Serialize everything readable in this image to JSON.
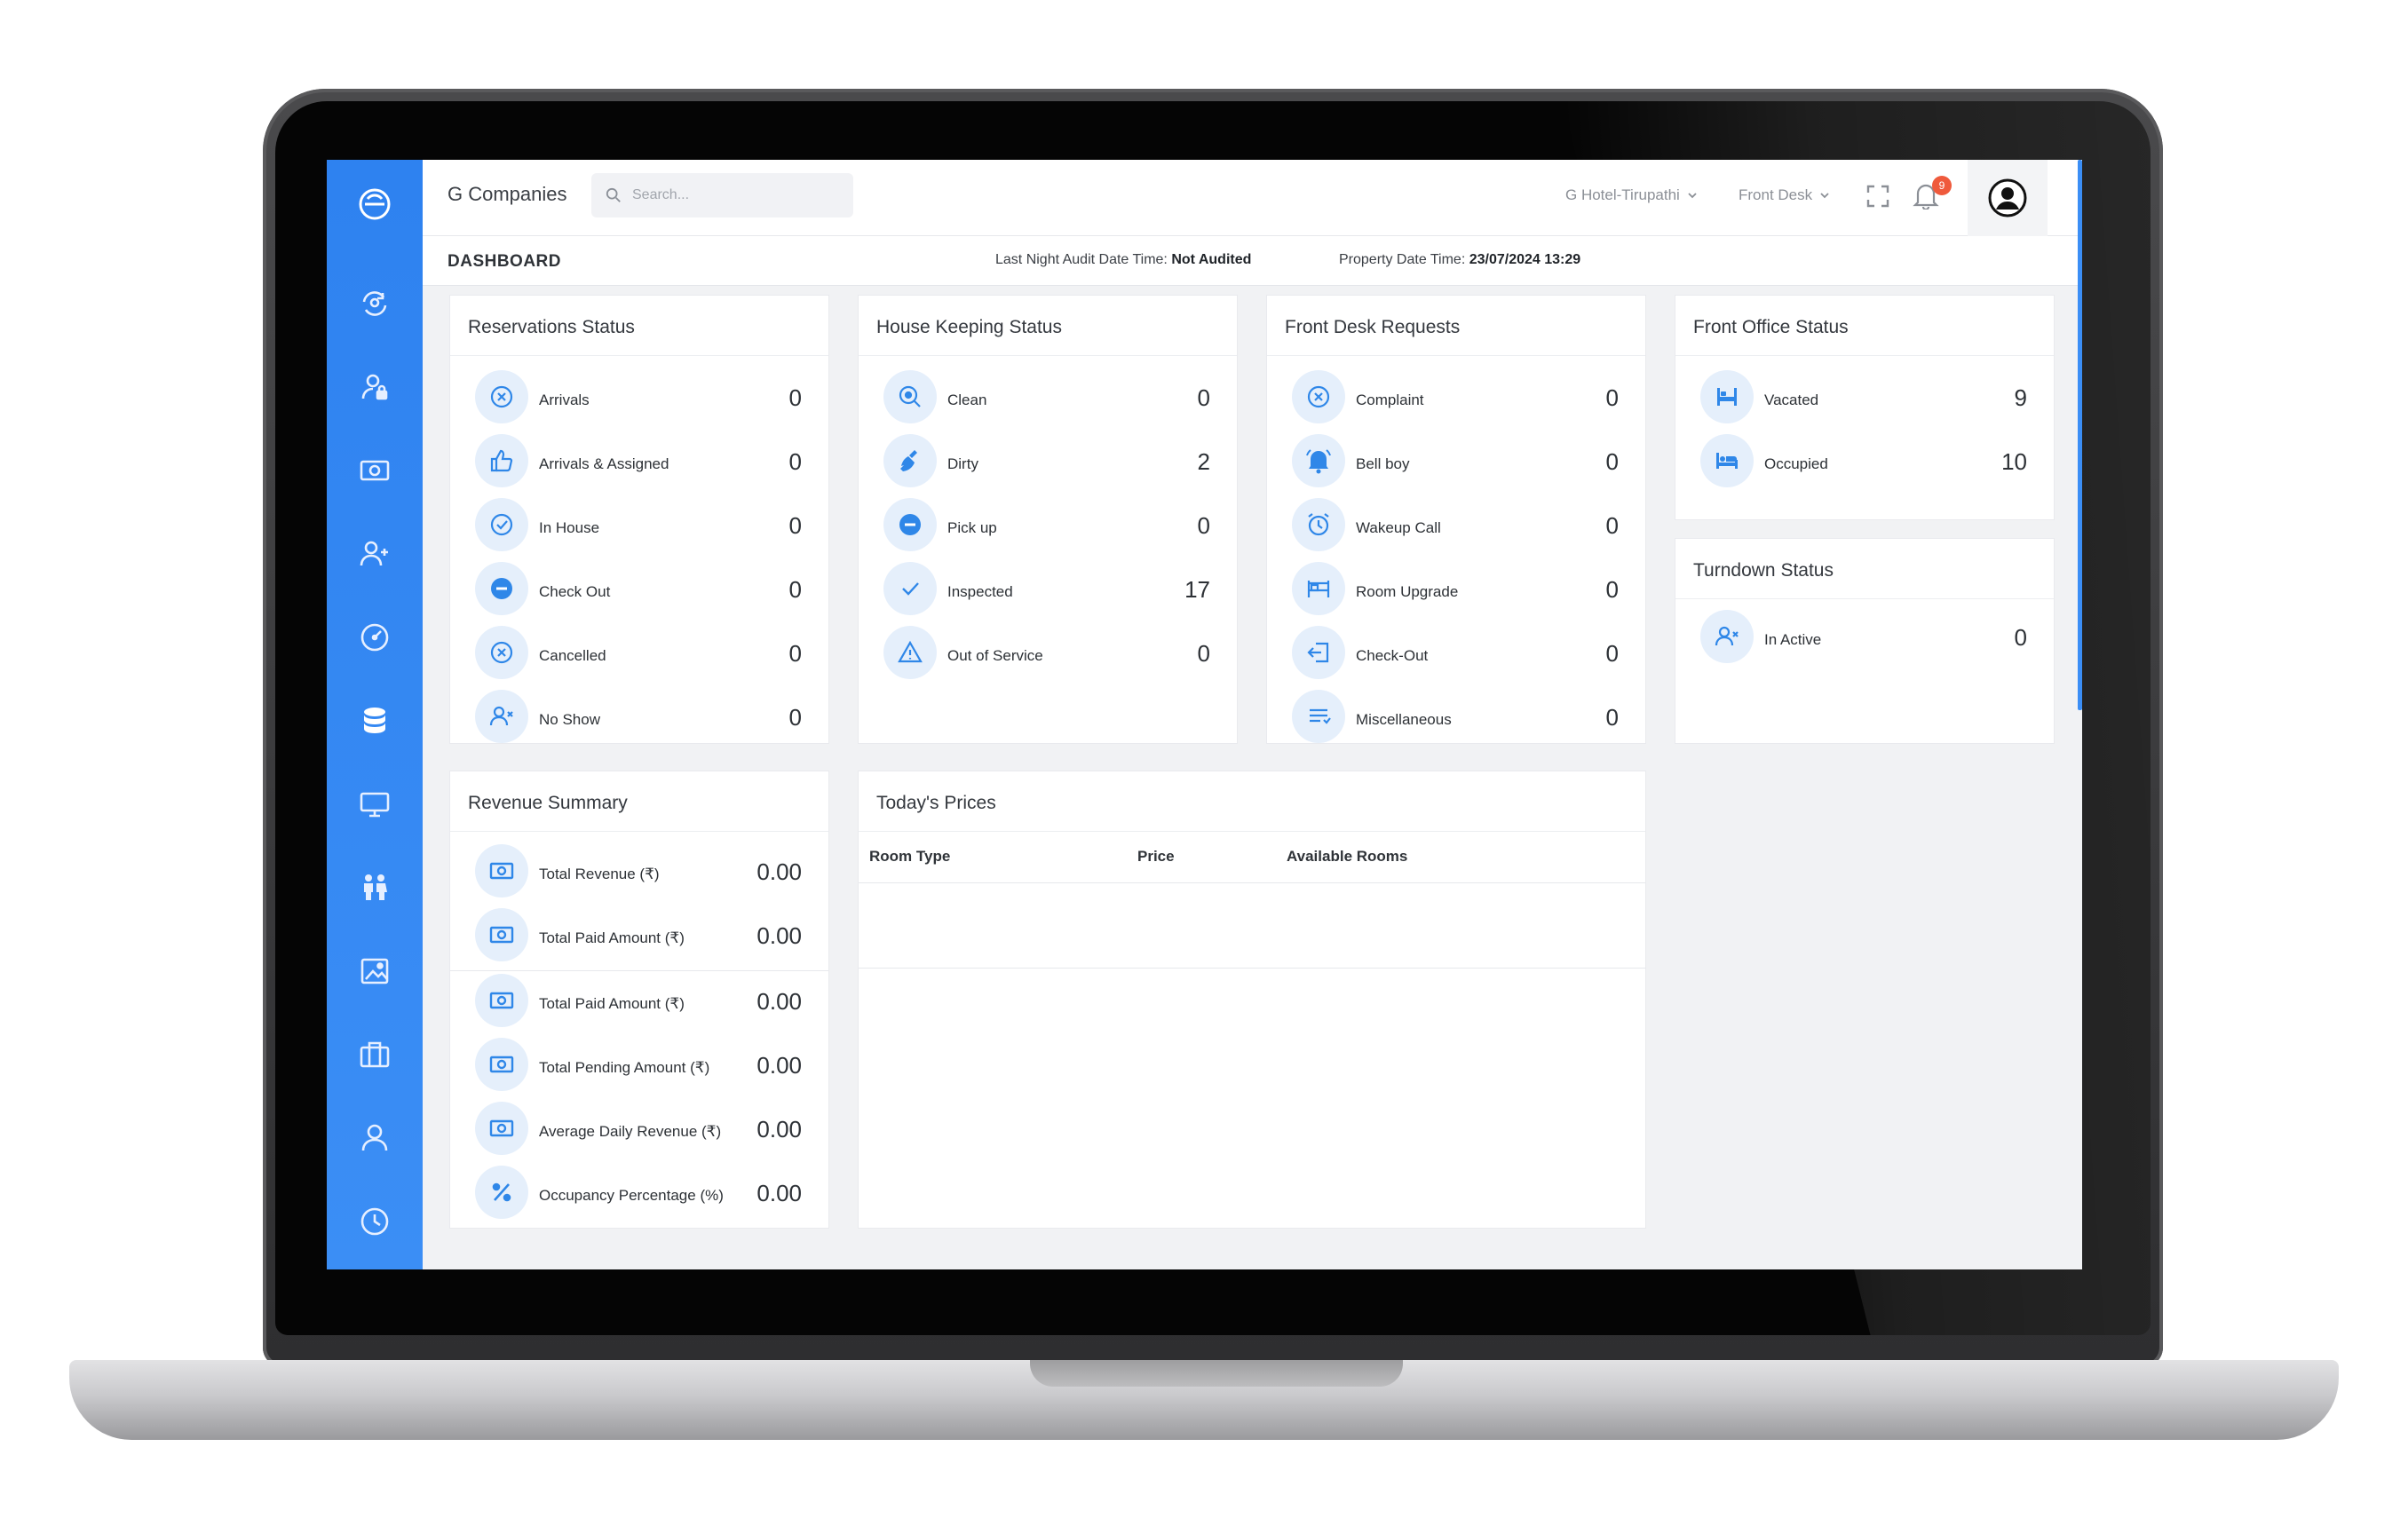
{
  "header": {
    "company": "G Companies",
    "search_placeholder": "Search...",
    "hotel_selector": "G Hotel-Tirupathi",
    "module_selector": "Front Desk",
    "notification_count": "9"
  },
  "subheader": {
    "title": "DASHBOARD",
    "audit_label": "Last Night Audit Date Time:",
    "audit_value": "Not Audited",
    "property_label": "Property Date Time:",
    "property_value": "23/07/2024 13:29"
  },
  "sidebar": {
    "icons": [
      "logo-icon",
      "refresh-user-icon",
      "user-lock-icon",
      "cash-icon",
      "user-add-icon",
      "speedometer-icon",
      "database-icon",
      "monitor-icon",
      "people-icon",
      "image-icon",
      "briefcase-icon",
      "user-icon",
      "clock-icon"
    ]
  },
  "reservations": {
    "title": "Reservations Status",
    "rows": [
      {
        "label": "Arrivals",
        "value": "0",
        "icon": "x-circle-icon"
      },
      {
        "label": "Arrivals & Assigned",
        "value": "0",
        "icon": "thumbs-up-icon"
      },
      {
        "label": "In House",
        "value": "0",
        "icon": "check-circle-icon"
      },
      {
        "label": "Check Out",
        "value": "0",
        "icon": "minus-circle-icon"
      },
      {
        "label": "Cancelled",
        "value": "0",
        "icon": "x-circle-icon"
      },
      {
        "label": "No Show",
        "value": "0",
        "icon": "user-x-icon"
      }
    ]
  },
  "housekeeping": {
    "title": "House Keeping Status",
    "rows": [
      {
        "label": "Clean",
        "value": "0",
        "icon": "search-clean-icon"
      },
      {
        "label": "Dirty",
        "value": "2",
        "icon": "broom-icon"
      },
      {
        "label": "Pick up",
        "value": "0",
        "icon": "minus-circle-icon"
      },
      {
        "label": "Inspected",
        "value": "17",
        "icon": "check-icon"
      },
      {
        "label": "Out of Service",
        "value": "0",
        "icon": "warning-icon"
      }
    ]
  },
  "frontdesk": {
    "title": "Front Desk Requests",
    "rows": [
      {
        "label": "Complaint",
        "value": "0",
        "icon": "x-circle-icon"
      },
      {
        "label": "Bell boy",
        "value": "0",
        "icon": "bell-icon"
      },
      {
        "label": "Wakeup Call",
        "value": "0",
        "icon": "alarm-icon"
      },
      {
        "label": "Room Upgrade",
        "value": "0",
        "icon": "bed-icon"
      },
      {
        "label": "Check-Out",
        "value": "0",
        "icon": "exit-icon"
      },
      {
        "label": "Miscellaneous",
        "value": "0",
        "icon": "list-icon"
      }
    ]
  },
  "frontoffice": {
    "title": "Front Office Status",
    "rows": [
      {
        "label": "Vacated",
        "value": "9",
        "icon": "bed-empty-icon"
      },
      {
        "label": "Occupied",
        "value": "10",
        "icon": "bed-occupied-icon"
      }
    ]
  },
  "turndown": {
    "title": "Turndown Status",
    "rows": [
      {
        "label": "In Active",
        "value": "0",
        "icon": "user-x-icon"
      }
    ]
  },
  "revenue": {
    "title": "Revenue Summary",
    "rows": [
      {
        "label": "Total Revenue (₹)",
        "value": "0.00",
        "icon": "cash-icon"
      },
      {
        "label": "Total Paid Amount (₹)",
        "value": "0.00",
        "icon": "cash-icon"
      },
      {
        "label": "Total Paid Amount (₹)",
        "value": "0.00",
        "icon": "cash-icon"
      },
      {
        "label": "Total Pending Amount (₹)",
        "value": "0.00",
        "icon": "cash-icon"
      },
      {
        "label": "Average Daily Revenue (₹)",
        "value": "0.00",
        "icon": "cash-icon"
      },
      {
        "label": "Occupancy Percentage (%)",
        "value": "0.00",
        "icon": "percent-icon"
      }
    ]
  },
  "prices": {
    "title": "Today's Prices",
    "columns": [
      "Room Type",
      "Price",
      "Available Rooms"
    ]
  },
  "colors": {
    "sidebar": "#3b8ef5",
    "accent": "#2f87e8",
    "icon_bg": "#e5effb",
    "badge": "#ef5a3c"
  }
}
